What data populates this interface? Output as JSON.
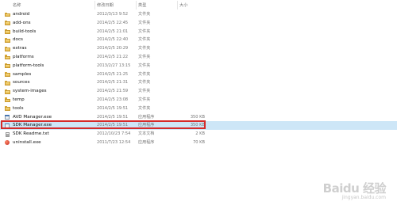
{
  "columns": {
    "name": "名称",
    "date": "修改日期",
    "type": "类型",
    "size": "大小"
  },
  "files": [
    {
      "name": "android",
      "date": "2012/3/13 9:52",
      "type": "文件夹",
      "size": "",
      "icon": "folder-icon"
    },
    {
      "name": "add-ons",
      "date": "2014/2/5 22:45",
      "type": "文件夹",
      "size": "",
      "icon": "folder-icon"
    },
    {
      "name": "build-tools",
      "date": "2014/2/5 21:01",
      "type": "文件夹",
      "size": "",
      "icon": "folder-icon"
    },
    {
      "name": "docs",
      "date": "2014/2/5 22:40",
      "type": "文件夹",
      "size": "",
      "icon": "folder-icon"
    },
    {
      "name": "extras",
      "date": "2014/2/5 20:29",
      "type": "文件夹",
      "size": "",
      "icon": "folder-icon"
    },
    {
      "name": "platforms",
      "date": "2014/2/5 21:22",
      "type": "文件夹",
      "size": "",
      "icon": "folder-icon"
    },
    {
      "name": "platform-tools",
      "date": "2013/2/27 13:15",
      "type": "文件夹",
      "size": "",
      "icon": "folder-icon"
    },
    {
      "name": "samples",
      "date": "2014/2/5 21:25",
      "type": "文件夹",
      "size": "",
      "icon": "folder-icon"
    },
    {
      "name": "sources",
      "date": "2014/2/5 21:31",
      "type": "文件夹",
      "size": "",
      "icon": "folder-icon"
    },
    {
      "name": "system-images",
      "date": "2014/2/5 21:59",
      "type": "文件夹",
      "size": "",
      "icon": "folder-icon"
    },
    {
      "name": "temp",
      "date": "2014/2/5 23:08",
      "type": "文件夹",
      "size": "",
      "icon": "folder-icon"
    },
    {
      "name": "tools",
      "date": "2014/2/5 19:51",
      "type": "文件夹",
      "size": "",
      "icon": "folder-icon"
    },
    {
      "name": "AVD Manager.exe",
      "date": "2014/2/5 19:51",
      "type": "应用程序",
      "size": "350 KB",
      "icon": "exe-icon"
    },
    {
      "name": "SDK Manager.exe",
      "date": "2014/2/5 19:51",
      "type": "应用程序",
      "size": "350 KB",
      "icon": "exe-icon",
      "selected": true
    },
    {
      "name": "SDK Readme.txt",
      "date": "2012/10/23 7:54",
      "type": "文本文档",
      "size": "2 KB",
      "icon": "text-file-icon"
    },
    {
      "name": "uninstall.exe",
      "date": "2011/7/23 12:54",
      "type": "应用程序",
      "size": "70 KB",
      "icon": "uninstall-icon"
    }
  ],
  "watermark": {
    "logo": "Baidu 经验",
    "url": "jingyan.baidu.com"
  },
  "colors": {
    "selection": "#cde6f7",
    "highlight_border": "#d52a2a",
    "folder": "#e7b94a"
  }
}
